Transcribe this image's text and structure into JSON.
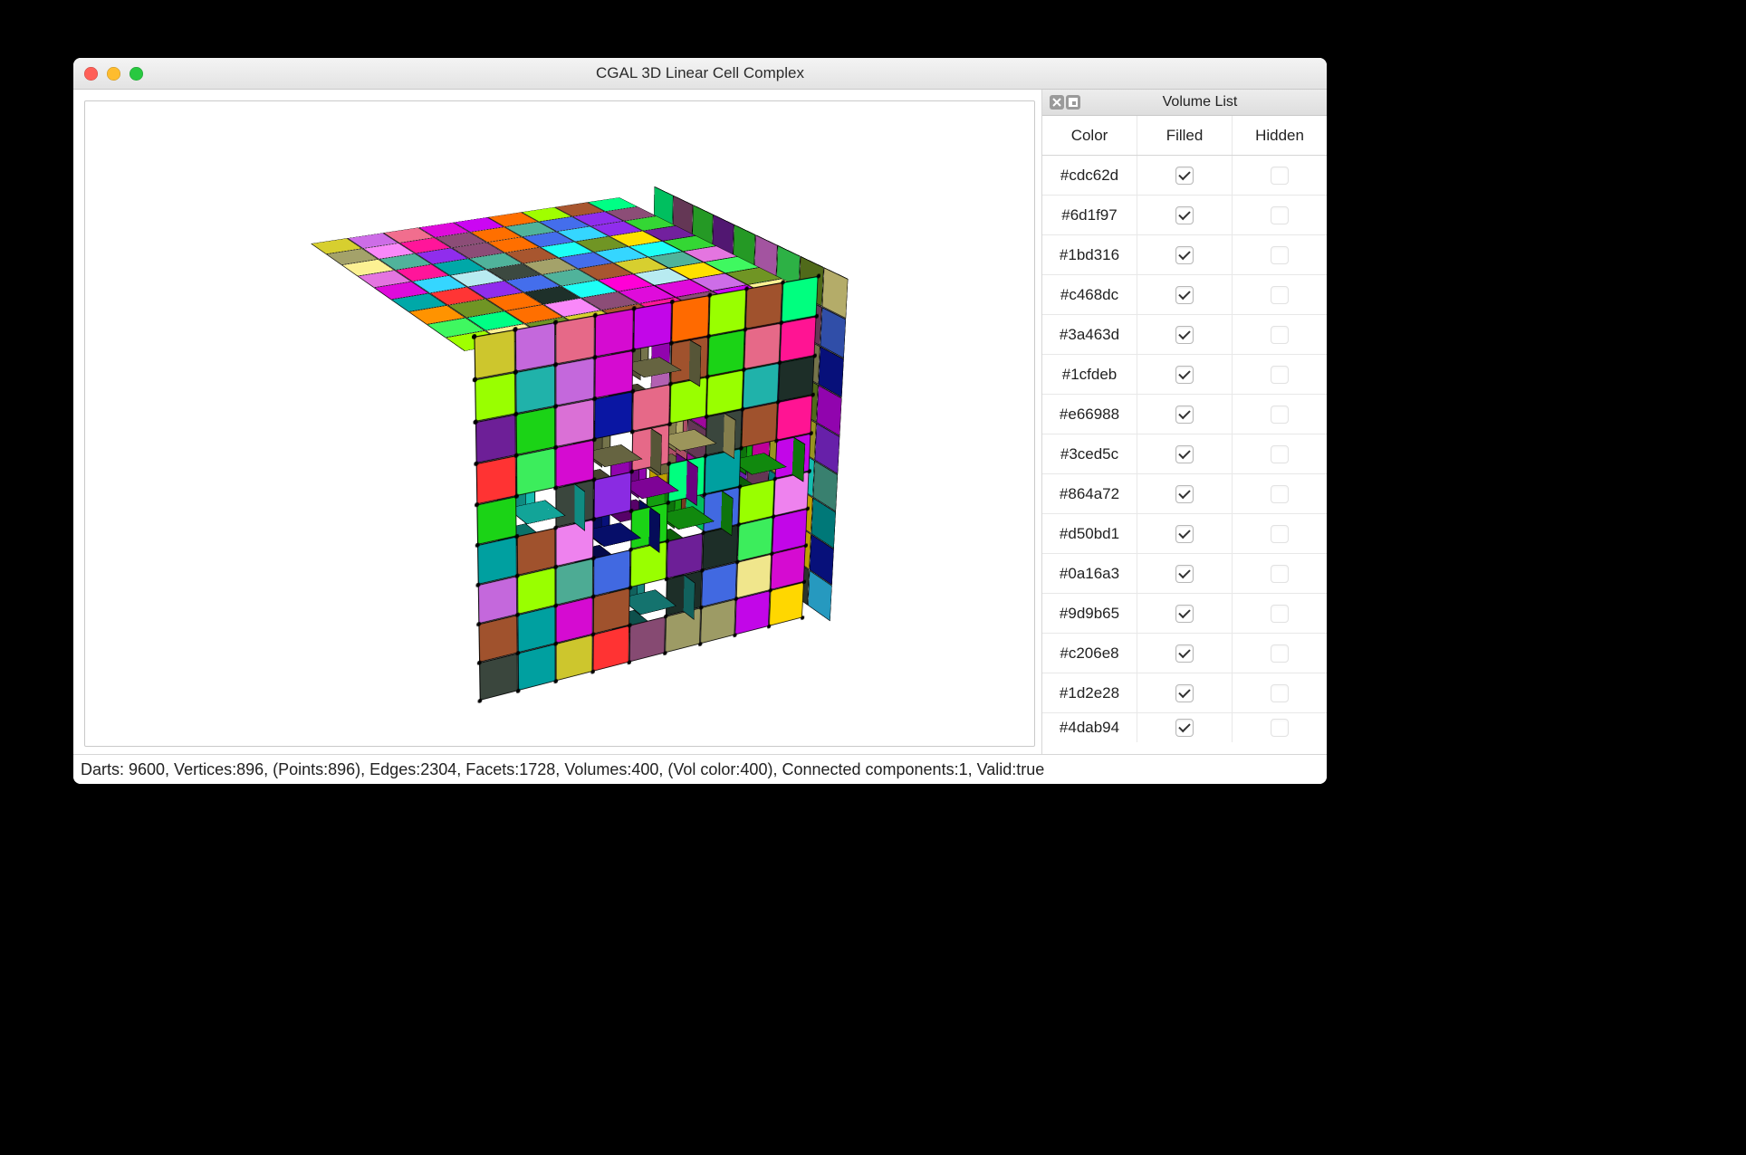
{
  "window": {
    "title": "CGAL 3D Linear Cell Complex"
  },
  "panel": {
    "title": "Volume List",
    "columns": {
      "color": "Color",
      "filled": "Filled",
      "hidden": "Hidden"
    },
    "rows": [
      {
        "color": "#cdc62d",
        "filled": true,
        "hidden": false
      },
      {
        "color": "#6d1f97",
        "filled": true,
        "hidden": false
      },
      {
        "color": "#1bd316",
        "filled": true,
        "hidden": false
      },
      {
        "color": "#c468dc",
        "filled": true,
        "hidden": false
      },
      {
        "color": "#3a463d",
        "filled": true,
        "hidden": false
      },
      {
        "color": "#1cfdeb",
        "filled": true,
        "hidden": false
      },
      {
        "color": "#e66988",
        "filled": true,
        "hidden": false
      },
      {
        "color": "#3ced5c",
        "filled": true,
        "hidden": false
      },
      {
        "color": "#864a72",
        "filled": true,
        "hidden": false
      },
      {
        "color": "#d50bd1",
        "filled": true,
        "hidden": false
      },
      {
        "color": "#0a16a3",
        "filled": true,
        "hidden": false
      },
      {
        "color": "#9d9b65",
        "filled": true,
        "hidden": false
      },
      {
        "color": "#c206e8",
        "filled": true,
        "hidden": false
      },
      {
        "color": "#1d2e28",
        "filled": true,
        "hidden": false
      },
      {
        "color": "#4dab94",
        "filled": true,
        "hidden": false
      }
    ]
  },
  "statusbar": {
    "text": "Darts: 9600,  Vertices:896,  (Points:896),  Edges:2304,  Facets:1728,  Volumes:400,  (Vol color:400),  Connected components:1,  Valid:true"
  },
  "scene": {
    "grid": 9,
    "unit": 44,
    "palette": [
      "#cdc62d",
      "#6d1f97",
      "#1bd316",
      "#c468dc",
      "#3a463d",
      "#1cfdeb",
      "#e66988",
      "#3ced5c",
      "#864a72",
      "#d50bd1",
      "#0a16a3",
      "#9d9b65",
      "#c206e8",
      "#1d2e28",
      "#4dab94",
      "#ff6a00",
      "#33ccff",
      "#ff00cc",
      "#99ff00",
      "#ff3333",
      "#00a0a0",
      "#a0522d",
      "#f0e68c",
      "#8a2be2",
      "#00ff7f",
      "#ff1493",
      "#4169e1",
      "#ffd700",
      "#b0e0e6",
      "#ee82ee",
      "#32cd32",
      "#ff8c00",
      "#6b8e23",
      "#da70d6",
      "#20b2aa"
    ],
    "holes": [
      [
        3,
        3
      ],
      [
        3,
        5
      ],
      [
        5,
        3
      ],
      [
        5,
        5
      ],
      [
        4,
        4
      ],
      [
        1,
        4
      ],
      [
        4,
        1
      ],
      [
        7,
        4
      ],
      [
        4,
        7
      ]
    ]
  }
}
